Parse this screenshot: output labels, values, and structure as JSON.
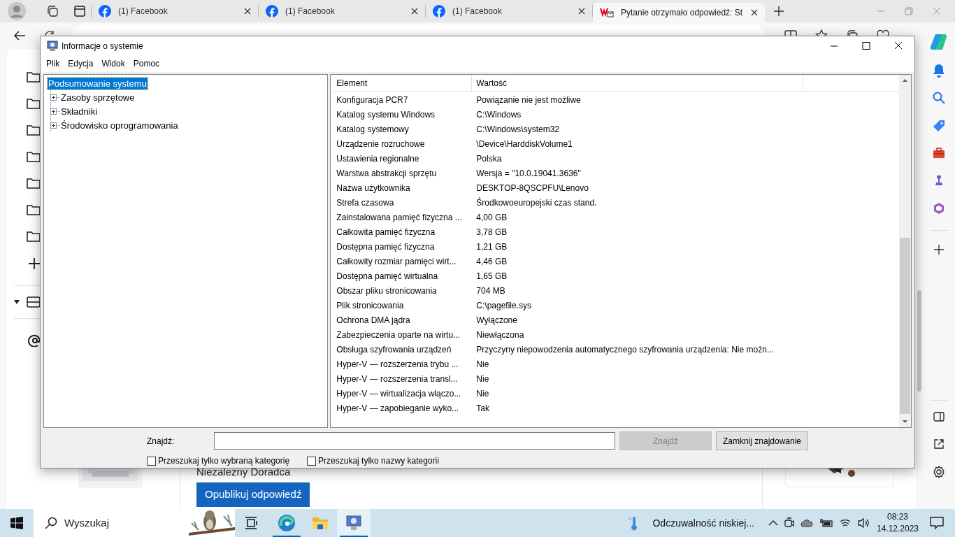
{
  "browser": {
    "tabs": [
      {
        "title": "(1) Facebook",
        "selected": false
      },
      {
        "title": "(1) Facebook",
        "selected": false
      },
      {
        "title": "(1) Facebook",
        "selected": false
      },
      {
        "title": "Pytanie otrzymało odpowiedź: St",
        "selected": true
      }
    ]
  },
  "page": {
    "author_label": "Niezależny Doradca",
    "publish_button": "Opublikuj odpowiedź"
  },
  "dialog": {
    "title": "Informacje o systemie",
    "menu": [
      "Plik",
      "Edycja",
      "Widok",
      "Pomoc"
    ],
    "tree": [
      {
        "label": "Podsumowanie systemu",
        "selected": true,
        "children": [
          {
            "label": "Zasoby sprzętowe",
            "expanded": false,
            "selected": false
          },
          {
            "label": "Składniki",
            "expanded": false,
            "selected": false
          },
          {
            "label": "Środowisko oprogramowania",
            "expanded": false,
            "selected": false
          }
        ]
      }
    ],
    "table": {
      "columns": [
        "Element",
        "Wartość"
      ],
      "rows": [
        [
          "Konfiguracja PCR7",
          "Powiązanie nie jest możliwe"
        ],
        [
          "Katalog systemu Windows",
          "C:\\Windows"
        ],
        [
          "Katalog systemowy",
          "C:\\Windows\\system32"
        ],
        [
          "Urządzenie rozruchowe",
          "\\Device\\HarddiskVolume1"
        ],
        [
          "Ustawienia regionalne",
          "Polska"
        ],
        [
          "Warstwa abstrakcji sprzętu",
          "Wersja = \"10.0.19041.3636\""
        ],
        [
          "Nazwa użytkownika",
          "DESKTOP-8QSCPFU\\Lenovo"
        ],
        [
          "Strefa czasowa",
          "Środkowoeuropejski czas stand."
        ],
        [
          "Zainstalowana pamięć fizyczna ...",
          "4,00 GB"
        ],
        [
          "Całkowita pamięć fizyczna",
          "3,78 GB"
        ],
        [
          "Dostępna pamięć fizyczna",
          "1,21 GB"
        ],
        [
          "Całkowity rozmiar pamięci wirt...",
          "4,46 GB"
        ],
        [
          "Dostępna pamięć wirtualna",
          "1,65 GB"
        ],
        [
          "Obszar pliku stronicowania",
          "704 MB"
        ],
        [
          "Plik stronicowania",
          "C:\\pagefile.sys"
        ],
        [
          "Ochrona DMA jądra",
          "Wyłączone"
        ],
        [
          "Zabezpieczenia oparte na wirtu...",
          "Niewłączona"
        ],
        [
          "Obsługa szyfrowania urządzeń",
          "Przyczyny niepowodzenia automatycznego szyfrowania urządzenia: Nie możn..."
        ],
        [
          "Hyper-V — rozszerzenia trybu ...",
          "Nie"
        ],
        [
          "Hyper-V — rozszerzenia transl...",
          "Nie"
        ],
        [
          "Hyper-V — wirtualizacja włączo...",
          "Nie"
        ],
        [
          "Hyper-V — zapobieganie wyko...",
          "Tak"
        ]
      ]
    },
    "find": {
      "label": "Znajdź:",
      "find_button": {
        "label": "Znajdź",
        "disabled": true
      },
      "close_button": "Zamknij znajdowanie",
      "options": [
        {
          "label": "Przeszukaj tylko wybraną kategorię",
          "checked": false
        },
        {
          "label": "Przeszukaj tylko nazwy kategorii",
          "checked": false
        }
      ]
    }
  },
  "taskbar": {
    "search_placeholder": "Wyszukaj",
    "apps": [
      {
        "kind": "taskview",
        "active": false,
        "selected": false
      },
      {
        "kind": "browser",
        "active": true,
        "selected": false
      },
      {
        "kind": "folder",
        "active": false,
        "selected": false
      },
      {
        "kind": "sysinfo",
        "active": true,
        "selected": true
      }
    ],
    "weather": "Odczuwalność niskiej...",
    "time": "08:23",
    "date": "14.12.2023"
  }
}
